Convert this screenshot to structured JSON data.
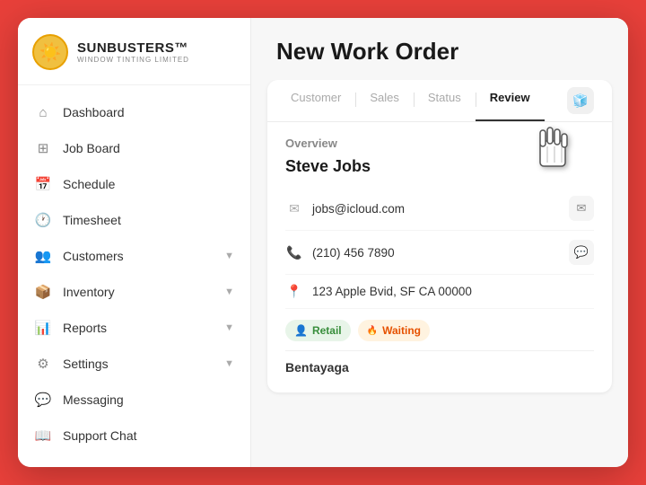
{
  "app": {
    "logo_icon": "☀️",
    "brand_name": "SUNBUSTERS™",
    "brand_sub": "WINDOW TINTING LIMITED"
  },
  "sidebar": {
    "items": [
      {
        "id": "dashboard",
        "icon": "⌂",
        "label": "Dashboard",
        "has_chevron": false
      },
      {
        "id": "job-board",
        "icon": "⊞",
        "label": "Job Board",
        "has_chevron": false
      },
      {
        "id": "schedule",
        "icon": "📅",
        "label": "Schedule",
        "has_chevron": false
      },
      {
        "id": "timesheet",
        "icon": "🕐",
        "label": "Timesheet",
        "has_chevron": false
      },
      {
        "id": "customers",
        "icon": "👥",
        "label": "Customers",
        "has_chevron": true
      },
      {
        "id": "inventory",
        "icon": "📦",
        "label": "Inventory",
        "has_chevron": true
      },
      {
        "id": "reports",
        "icon": "📊",
        "label": "Reports",
        "has_chevron": true
      },
      {
        "id": "settings",
        "icon": "⚙",
        "label": "Settings",
        "has_chevron": true
      },
      {
        "id": "messaging",
        "icon": "💬",
        "label": "Messaging",
        "has_chevron": false
      },
      {
        "id": "support-chat",
        "icon": "📖",
        "label": "Support Chat",
        "has_chevron": false
      }
    ]
  },
  "main": {
    "title": "New Work Order",
    "tabs": [
      {
        "id": "customer",
        "label": "Customer",
        "active": false
      },
      {
        "id": "sales",
        "label": "Sales",
        "active": false
      },
      {
        "id": "status",
        "label": "Status",
        "active": false
      },
      {
        "id": "review",
        "label": "Review",
        "active": true
      }
    ],
    "tab_icon": "🧊",
    "overview": {
      "section_label": "Overview",
      "customer_name": "Steve Jobs",
      "email": "jobs@icloud.com",
      "phone": "(210) 456 7890",
      "address": "123 Apple Bvid, SF CA 00000",
      "tags": [
        {
          "id": "retail",
          "label": "Retail",
          "icon": "👤"
        },
        {
          "id": "waiting",
          "label": "Waiting",
          "icon": "🟠"
        }
      ],
      "next_section": "Bentayaga"
    }
  }
}
